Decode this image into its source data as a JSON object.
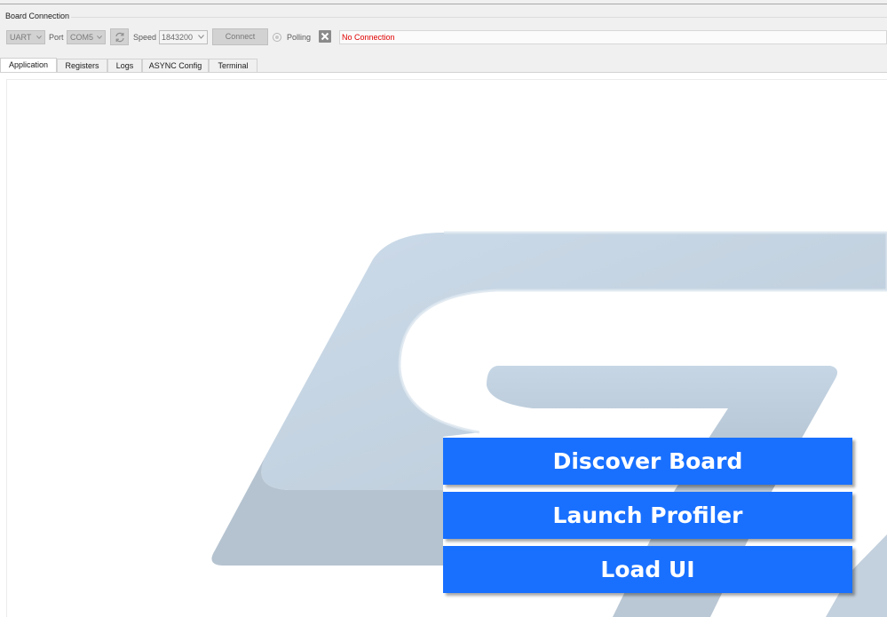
{
  "group": {
    "title": "Board Connection"
  },
  "toolbar": {
    "interface_value": "UART",
    "port_label": "Port",
    "port_value": "COM5",
    "speed_label": "Speed",
    "speed_value": "1843200",
    "connect_label": "Connect",
    "polling_label": "Polling",
    "status_text": "No Connection",
    "status_color": "#e00000"
  },
  "tabs": [
    {
      "label": "Application",
      "active": true
    },
    {
      "label": "Registers"
    },
    {
      "label": "Logs"
    },
    {
      "label": "ASYNC Config"
    },
    {
      "label": "Terminal"
    }
  ],
  "actions": {
    "discover_label": "Discover Board",
    "profiler_label": "Launch Profiler",
    "load_ui_label": "Load UI",
    "button_color": "#1970ff"
  },
  "icons": [
    "refresh-icon",
    "close-icon",
    "chevron-down-icon",
    "st-logo-watermark"
  ]
}
